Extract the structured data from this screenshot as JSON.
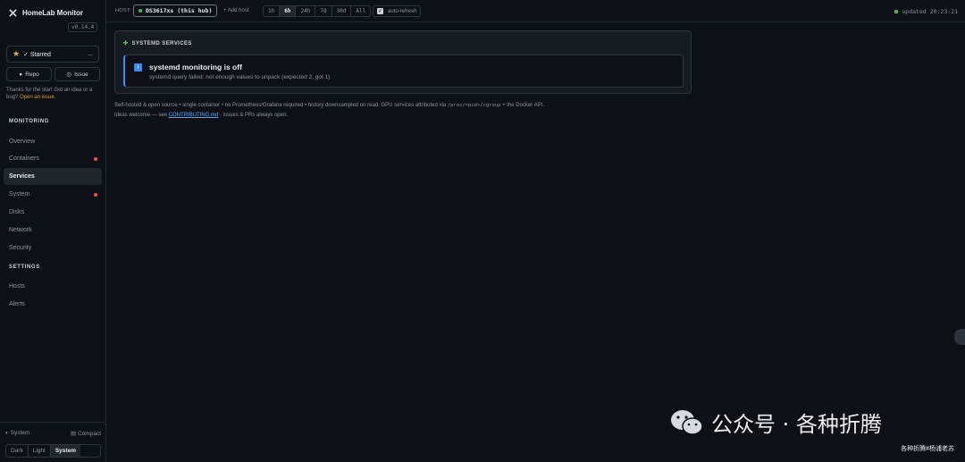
{
  "app": {
    "name": "HomeLab Monitor",
    "version": "v0.14.4"
  },
  "sidebar": {
    "starred_label": "✓ Starred",
    "more_label": "...",
    "repo_label": "Repo",
    "issue_label": "Issue",
    "thanks_text": "Thanks for the star! Got an idea or a bug?",
    "thanks_link": "Open an issue.",
    "sections": {
      "monitoring": "MONITORING",
      "settings": "SETTINGS"
    },
    "items": [
      {
        "label": "Overview"
      },
      {
        "label": "Containers",
        "alert": true
      },
      {
        "label": "Services",
        "active": true
      },
      {
        "label": "System",
        "alert": true
      },
      {
        "label": "Disks"
      },
      {
        "label": "Network"
      },
      {
        "label": "Security"
      }
    ],
    "settings_items": [
      {
        "label": "Hosts"
      },
      {
        "label": "Alerts"
      }
    ],
    "theme_label": "System",
    "compact_label": "Compact",
    "theme_options": [
      "Dark",
      "Light",
      "System"
    ],
    "theme_selected": "System"
  },
  "topbar": {
    "host_label": "HOST:",
    "host_name": "DS3617xs (this hub)",
    "add_host": "+ Add host",
    "ranges": [
      "1h",
      "6h",
      "24h",
      "7d",
      "30d",
      "All"
    ],
    "range_selected": "6h",
    "auto_refresh_label": "auto-refresh",
    "auto_refresh": true,
    "updated_text": "updated 20:23:21"
  },
  "panel": {
    "title": "SYSTEMD SERVICES",
    "alert_title": "systemd monitoring is off",
    "alert_message": "systemd query failed: not enough values to unpack (expected 2, got 1)"
  },
  "footer": {
    "line1_a": "Self-hosted & open source • single container • no Prometheus/Grafana required • history downsampled on read. GPU services attributed via",
    "line1_code": "/proc/<pid>/cgroup",
    "line1_b": "+ the Docker API.",
    "line2_a": "Ideas welcome — see",
    "line2_link": "CONTRIBUTING.md",
    "line2_b": "· issues & PRs always open."
  },
  "watermark": {
    "main": "公众号 · 各种折腾",
    "sub": "各种折腾#杨浦老苏"
  },
  "colors": {
    "accent": "#388bfd",
    "alert_dot": "#f85149",
    "ok_dot": "#3fb950",
    "link": "#58a6ff",
    "warn_link": "#d29922"
  }
}
